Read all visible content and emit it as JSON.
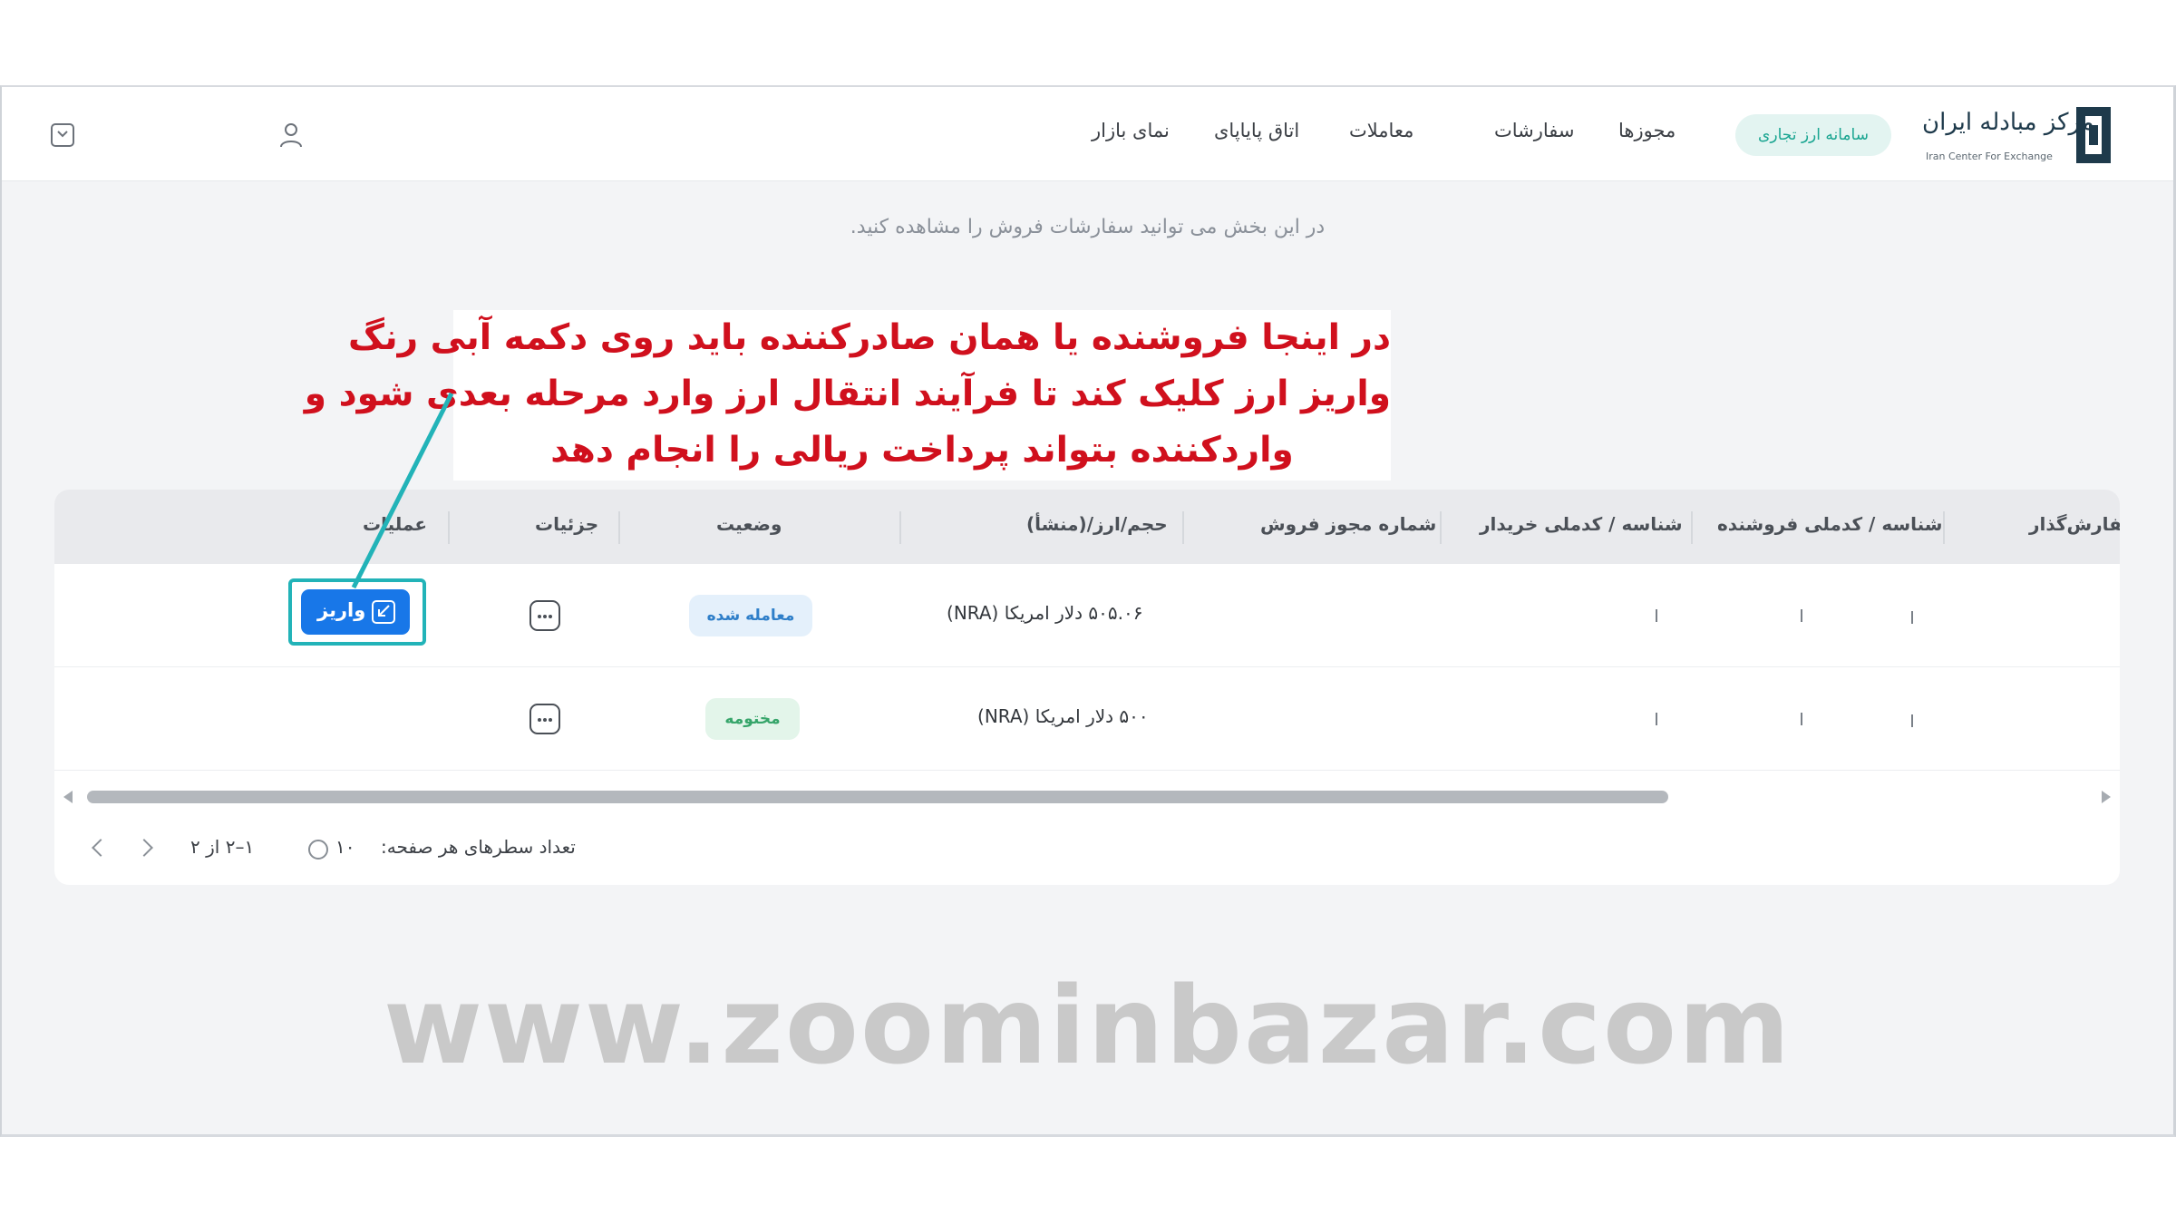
{
  "nav": {
    "items": [
      "نمای بازار",
      "اتاق پایاپای",
      "معاملات",
      "سفارشات",
      "مجوزها"
    ],
    "active_pill": "سامانه ارز تجاری",
    "logo_text": "مرکز مبادله ایران",
    "logo_sub": "Iran Center For Exchange"
  },
  "page": {
    "subtitle": "در این بخش می توانید سفارشات فروش را مشاهده کنید."
  },
  "table": {
    "headers": {
      "order_submitter": "سفارش‌گذار",
      "seller_id": "شناسه / کدملی فروشنده",
      "buyer_id": "شناسه / کدملی خریدار",
      "sale_permit": "شماره مجوز فروش",
      "volume": "حجم/ارز/(منشأ)",
      "status": "وضعیت",
      "details": "جزئیات",
      "actions": "عملیات"
    },
    "rows": [
      {
        "volume": "۵۰۵.۰۶ دلار امریکا (NRA)",
        "status": "معامله شده",
        "action_label": "واریز"
      },
      {
        "volume": "۵۰۰ دلار امریکا (NRA)",
        "status": "مختومه"
      }
    ]
  },
  "pagination": {
    "rows_per_page_label": "تعداد سطرهای هر صفحه:",
    "rows_per_page_value": "۱۰",
    "range": "۱–۲ از ۲"
  },
  "annotation": {
    "lines": [
      "در اینجا فروشنده یا همان صادرکننده باید روی دکمه آبی رنگ",
      "واریز ارز کلیک کند تا فرآیند انتقال ارز وارد مرحله بعدی شود و",
      "واردکننده بتواند پرداخت ریالی را انجام دهد"
    ]
  },
  "watermark": "www.zoominbazar.com",
  "colors": {
    "accent_teal": "#1aa591",
    "deposit_blue": "#1877e8",
    "highlight_cyan": "#22b3b8",
    "annotation_red": "#d0101d"
  },
  "icons": [
    "logo-mark-icon",
    "user-icon",
    "chevron-down-icon",
    "more-dots-icon",
    "deposit-icon",
    "chevron-left-icon",
    "chevron-right-icon"
  ]
}
